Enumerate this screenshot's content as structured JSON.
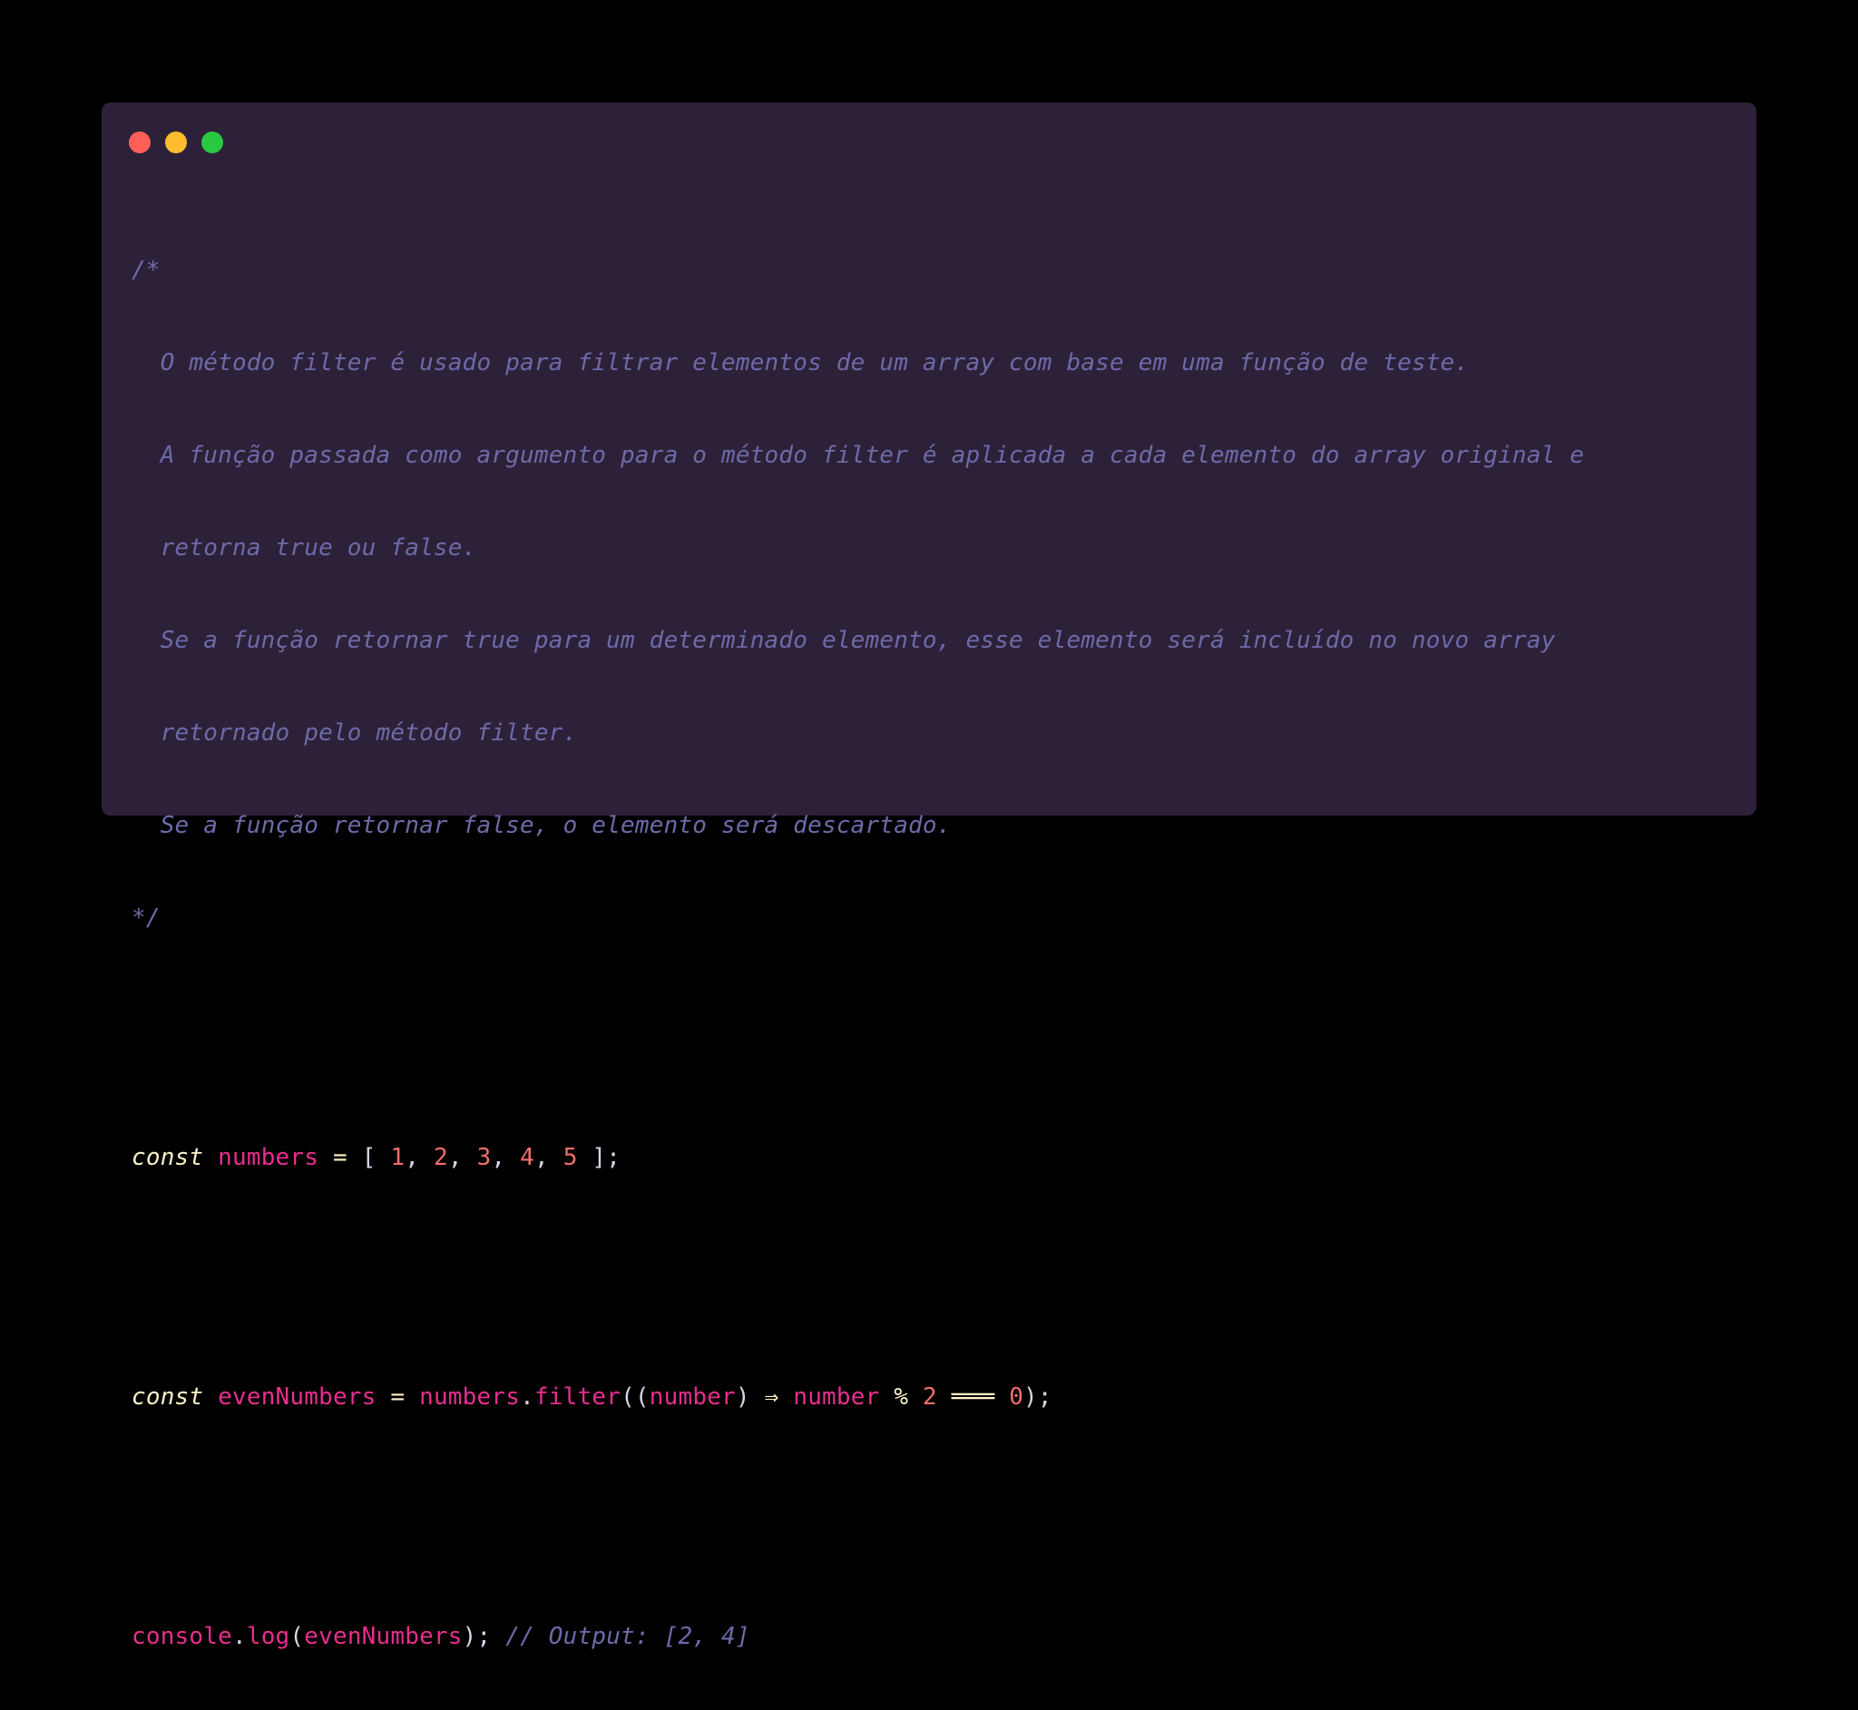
{
  "window_controls": {
    "close": "close",
    "minimize": "minimize",
    "maximize": "maximize"
  },
  "comment_block": [
    "/*",
    "  O método filter é usado para filtrar elementos de um array com base em uma função de teste.",
    "  A função passada como argumento para o método filter é aplicada a cada elemento do array original e",
    "  retorna true ou false.",
    "  Se a função retornar true para um determinado elemento, esse elemento será incluído no novo array",
    "  retornado pelo método filter.",
    "  Se a função retornar false, o elemento será descartado.",
    "*/"
  ],
  "line_numbers": {
    "keyword": "const",
    "name": "numbers",
    "assign": " = ",
    "open": "[ ",
    "values": [
      "1",
      "2",
      "3",
      "4",
      "5"
    ],
    "sep": ", ",
    "close": " ];"
  },
  "line_filter": {
    "keyword": "const",
    "name": "evenNumbers",
    "assign": " = ",
    "object": "numbers",
    "dot": ".",
    "method": "filter",
    "open": "((",
    "param": "number",
    "close_param": ") ",
    "arrow": "⇒",
    "body_var": "number",
    "mod": "%",
    "divisor": "2",
    "eq": "═══",
    "zero": "0",
    "end": ");"
  },
  "line_log": {
    "object": "console",
    "dot": ".",
    "method": "log",
    "open": "(",
    "arg": "evenNumbers",
    "end": ");",
    "comment": "// Output: [2, 4]"
  },
  "colors": {
    "background": "#000000",
    "editor": "#2d2139",
    "comment": "#6d6aa8",
    "keyword": "#fbf0c8",
    "identifier": "#e62e8f",
    "number": "#ef6f6b",
    "text": "#d8d5e6"
  }
}
